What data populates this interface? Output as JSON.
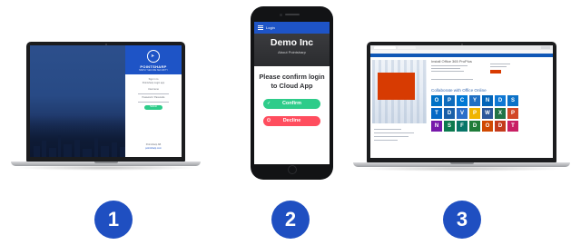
{
  "laptop1": {
    "brand": "POINTSHARP",
    "tagline": "SIMPLY SECURE SECURITY",
    "lines": [
      "Sign in to",
      "Pointsharp Login app",
      "Username",
      "Password / Passcode"
    ],
    "button": "Submit",
    "footer": [
      "Pointsharp AB",
      "pointsharp.com"
    ]
  },
  "phone": {
    "nav_title": "Login",
    "company": "Demo Inc",
    "subtitle": "About Pointsharp",
    "question_line1": "Please confirm login",
    "question_line2": "to Cloud App",
    "confirm_label": "Confirm",
    "decline_label": "Decline",
    "colors": {
      "brand_blue": "#1e54c6",
      "confirm_green": "#2ecc8a",
      "decline_red": "#ff4d5e"
    }
  },
  "laptop3": {
    "page_heading": "Install Office 365 ProPlus",
    "apps_title": "Collaborate with Office Online",
    "tiles": [
      {
        "letter": "O",
        "color": "#0072c6",
        "icon": "outlook-icon"
      },
      {
        "letter": "P",
        "color": "#0f6cbd",
        "icon": "people-icon"
      },
      {
        "letter": "C",
        "color": "#0078d4",
        "icon": "calendar-icon"
      },
      {
        "letter": "Y",
        "color": "#1f6fc4",
        "icon": "yammer-icon"
      },
      {
        "letter": "N",
        "color": "#0364b8",
        "icon": "newsfeed-icon"
      },
      {
        "letter": "D",
        "color": "#0f78d4",
        "icon": "onedrive-icon"
      },
      {
        "letter": "S",
        "color": "#0b71c7",
        "icon": "sites-icon"
      },
      {
        "letter": "T",
        "color": "#0468c5",
        "icon": "tasks-icon"
      },
      {
        "letter": "D",
        "color": "#1a5fa8",
        "icon": "delve-icon"
      },
      {
        "letter": "V",
        "color": "#2a6ec9",
        "icon": "video-icon"
      },
      {
        "letter": "P",
        "color": "#f0b400",
        "icon": "planner-icon"
      },
      {
        "letter": "W",
        "color": "#2b579a",
        "icon": "word-icon"
      },
      {
        "letter": "X",
        "color": "#217346",
        "icon": "excel-icon"
      },
      {
        "letter": "P",
        "color": "#d24726",
        "icon": "powerpoint-icon"
      },
      {
        "letter": "N",
        "color": "#7719aa",
        "icon": "onenote-icon"
      },
      {
        "letter": "S",
        "color": "#0b7a4f",
        "icon": "sway-icon"
      },
      {
        "letter": "F",
        "color": "#077568",
        "icon": "forms-icon"
      },
      {
        "letter": "D",
        "color": "#1f7c39",
        "icon": "dynamics-icon"
      },
      {
        "letter": "O",
        "color": "#d04a02",
        "icon": "office-icon"
      },
      {
        "letter": "D",
        "color": "#c43b1b",
        "icon": "docs-icon"
      },
      {
        "letter": "T",
        "color": "#c82064",
        "icon": "tv-icon"
      }
    ]
  },
  "steps": [
    "1",
    "2",
    "3"
  ],
  "colors": {
    "step_circle": "#1f4fc1"
  }
}
